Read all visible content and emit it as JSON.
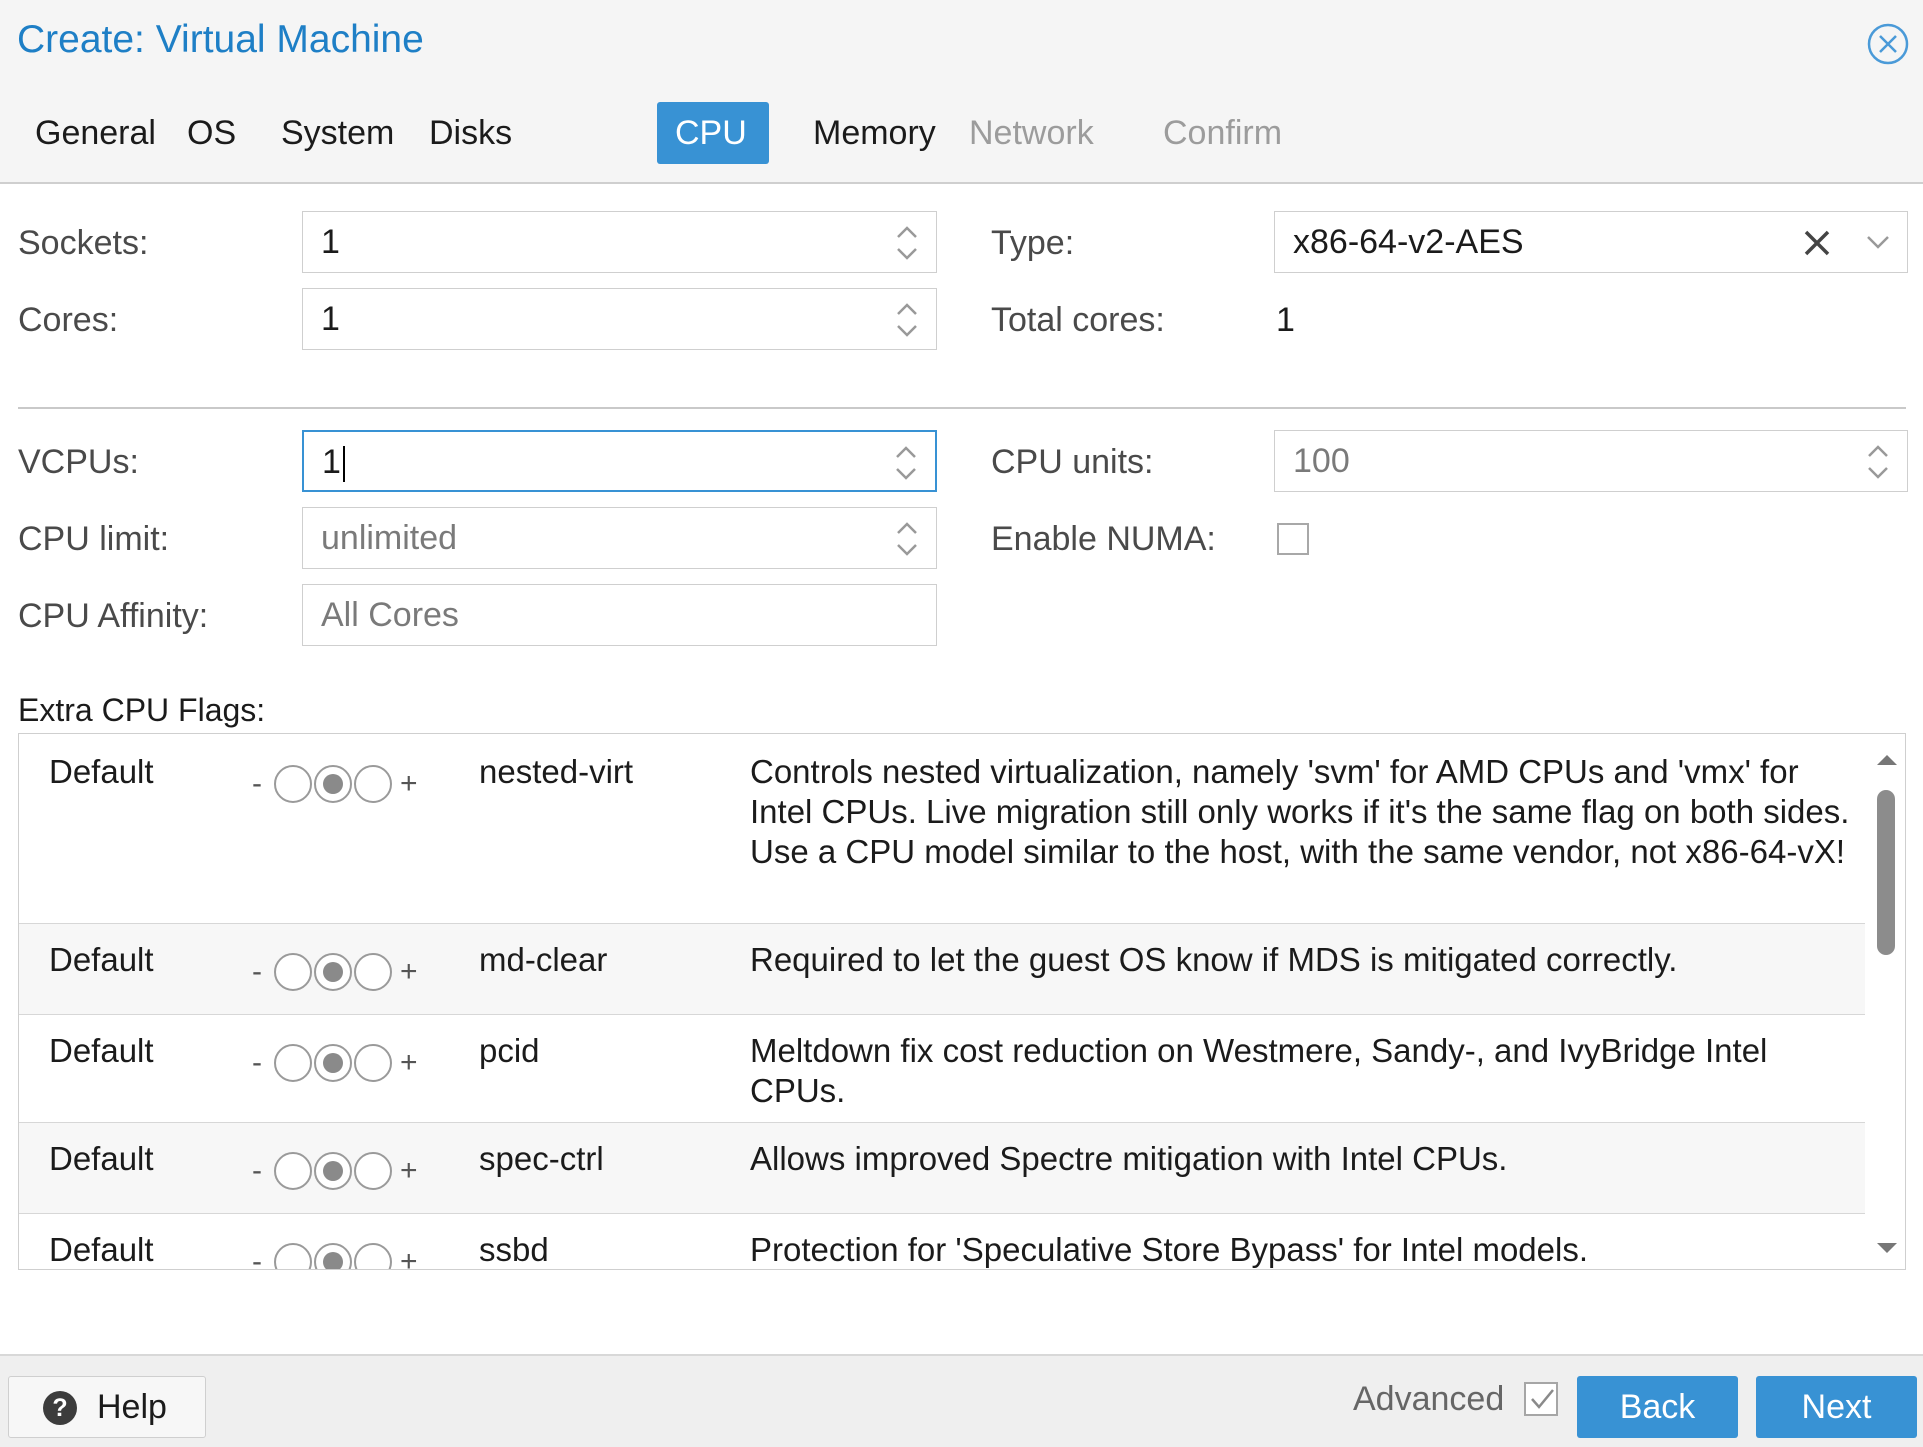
{
  "window": {
    "title": "Create: Virtual Machine",
    "close_icon": "close-circle-icon"
  },
  "tabs": [
    {
      "label": "General",
      "state": "normal"
    },
    {
      "label": "OS",
      "state": "normal"
    },
    {
      "label": "System",
      "state": "normal"
    },
    {
      "label": "Disks",
      "state": "normal"
    },
    {
      "label": "CPU",
      "state": "active"
    },
    {
      "label": "Memory",
      "state": "normal"
    },
    {
      "label": "Network",
      "state": "disabled"
    },
    {
      "label": "Confirm",
      "state": "disabled"
    }
  ],
  "form": {
    "sockets": {
      "label": "Sockets:",
      "value": "1"
    },
    "cores": {
      "label": "Cores:",
      "value": "1"
    },
    "type": {
      "label": "Type:",
      "value": "x86-64-v2-AES"
    },
    "total_cores": {
      "label": "Total cores:",
      "value": "1"
    },
    "vcpus": {
      "label": "VCPUs:",
      "value": "1"
    },
    "cpu_units": {
      "label": "CPU units:",
      "placeholder": "100"
    },
    "cpu_limit": {
      "label": "CPU limit:",
      "placeholder": "unlimited"
    },
    "enable_numa": {
      "label": "Enable NUMA:",
      "checked": false
    },
    "cpu_affinity": {
      "label": "CPU Affinity:",
      "placeholder": "All Cores"
    }
  },
  "flags": {
    "label": "Extra CPU Flags:",
    "minus": "-",
    "plus": "+",
    "rows": [
      {
        "state": "Default",
        "name": "nested-virt",
        "description": "Controls nested virtualization, namely 'svm' for AMD CPUs and 'vmx' for Intel CPUs. Live migration still only works if it's the same flag on both sides. Use a CPU model similar to the host, with the same vendor, not x86-64-vX!"
      },
      {
        "state": "Default",
        "name": "md-clear",
        "description": "Required to let the guest OS know if MDS is mitigated correctly."
      },
      {
        "state": "Default",
        "name": "pcid",
        "description": "Meltdown fix cost reduction on Westmere, Sandy-, and IvyBridge Intel CPUs."
      },
      {
        "state": "Default",
        "name": "spec-ctrl",
        "description": "Allows improved Spectre mitigation with Intel CPUs."
      },
      {
        "state": "Default",
        "name": "ssbd",
        "description": "Protection for 'Speculative Store Bypass' for Intel models."
      }
    ]
  },
  "footer": {
    "help_label": "Help",
    "advanced_label": "Advanced",
    "advanced_checked": true,
    "back_label": "Back",
    "next_label": "Next"
  },
  "colors": {
    "accent": "#3892d4",
    "title": "#1e7fc6"
  }
}
